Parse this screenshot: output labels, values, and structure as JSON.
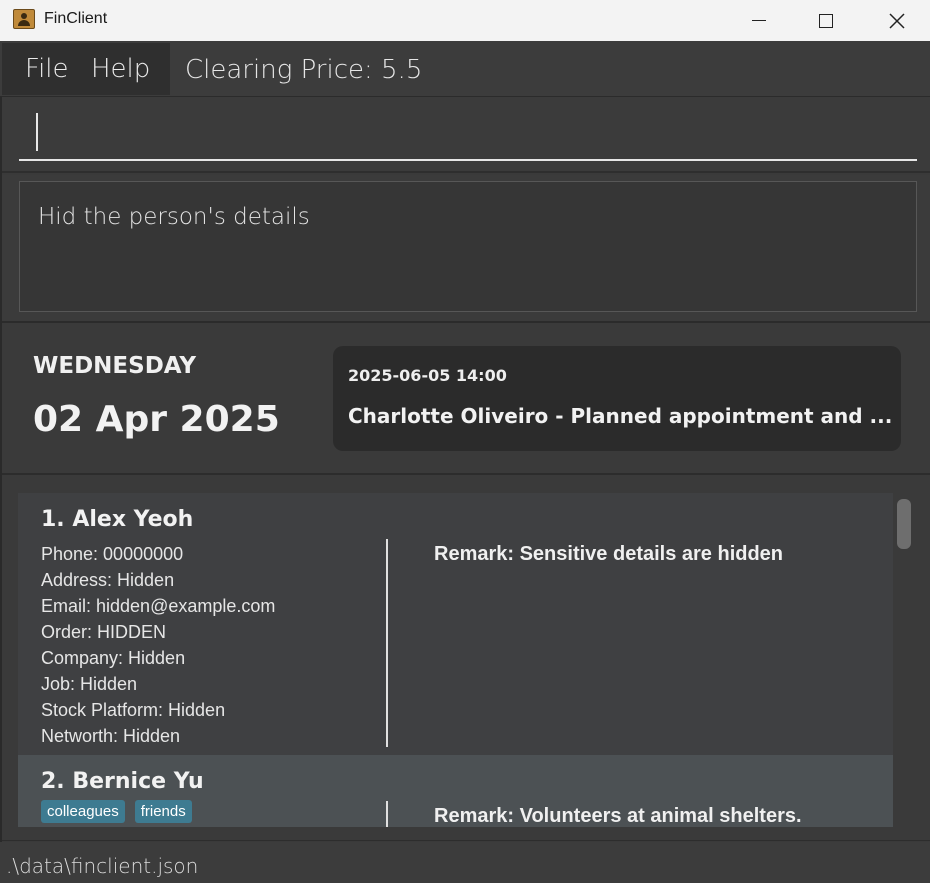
{
  "window": {
    "title": "FinClient"
  },
  "menu": {
    "file": "File",
    "help": "Help",
    "clearing_price": "Clearing Price: 5.5"
  },
  "command": {
    "value": ""
  },
  "result": {
    "text": "Hid the person's details"
  },
  "calendar": {
    "weekday": "WEDNESDAY",
    "date": "02 Apr 2025"
  },
  "upcoming": {
    "time": "2025-06-05 14:00",
    "description": "Charlotte Oliveiro - Planned appointment and ..."
  },
  "persons": [
    {
      "name": "1. Alex Yeoh",
      "phone": "Phone: 00000000",
      "address": "Address: Hidden",
      "email": "Email: hidden@example.com",
      "order": "Order: HIDDEN",
      "company": "Company: Hidden",
      "job": "Job: Hidden",
      "stock_platform": "Stock Platform: Hidden",
      "networth": "Networth: Hidden",
      "remark": "Remark: Sensitive details are hidden"
    },
    {
      "name": "2. Bernice Yu",
      "tags": [
        "colleagues",
        "friends"
      ],
      "remark": "Remark: Volunteers at animal shelters."
    }
  ],
  "status": {
    "path": ".\\data\\finclient.json"
  },
  "icons": {
    "app": "contact-book-icon",
    "minimize": "minimize-icon",
    "maximize": "maximize-icon",
    "close": "close-icon"
  }
}
